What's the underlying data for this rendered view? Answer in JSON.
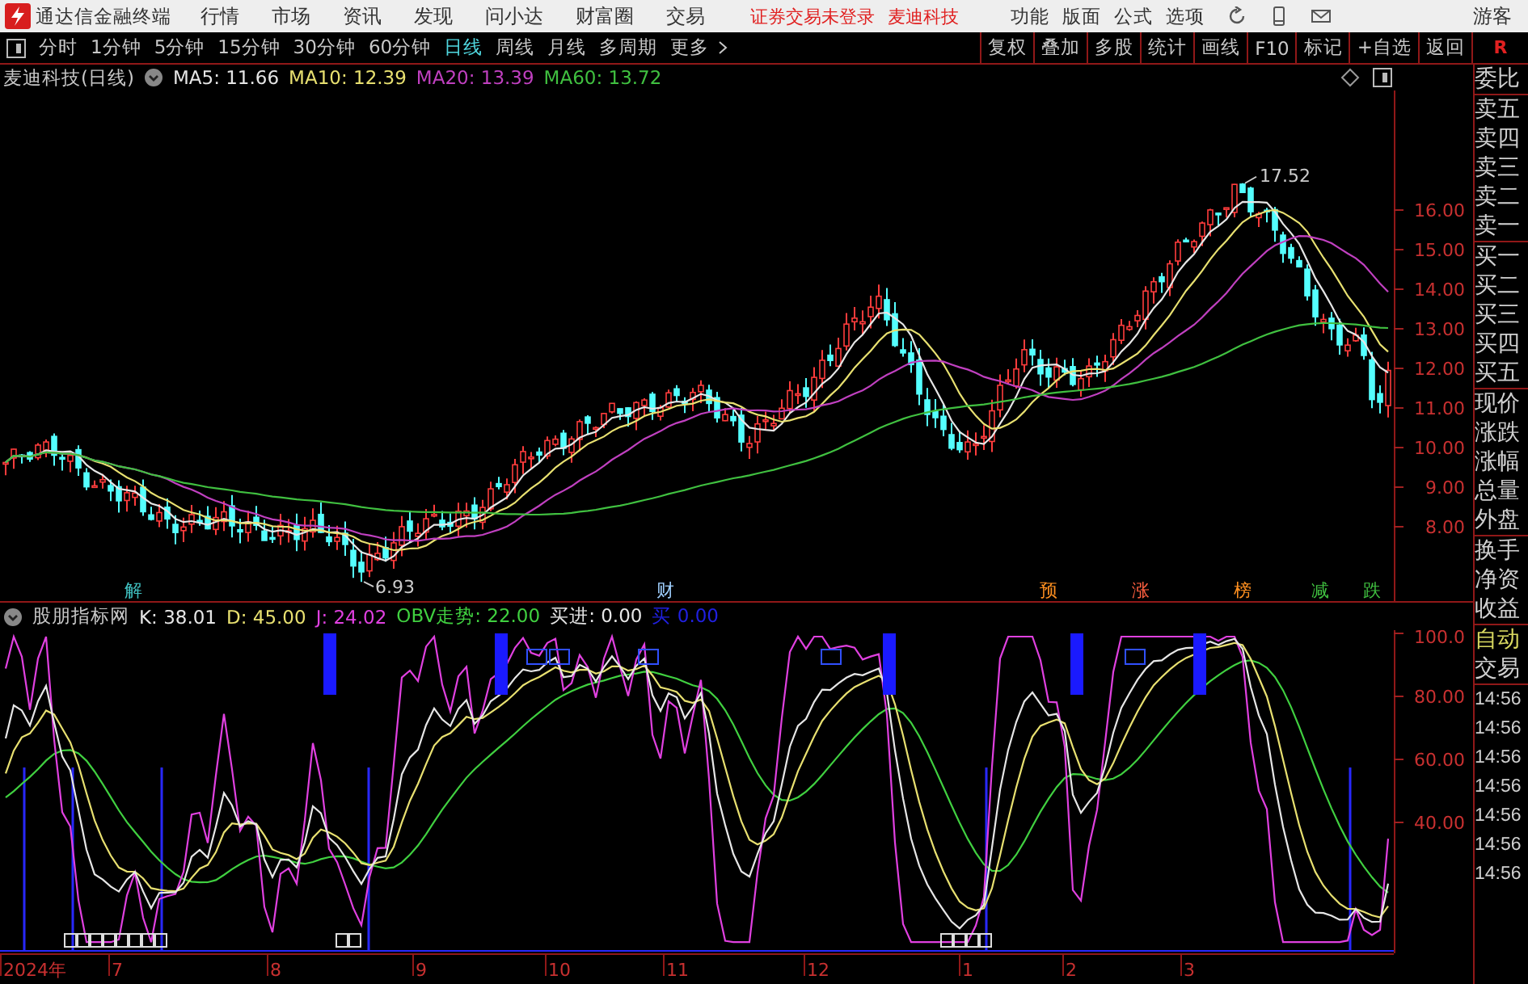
{
  "menu_bar": {
    "app_name": "通达信金融终端",
    "items": [
      "行情",
      "市场",
      "资讯",
      "发现",
      "问小达",
      "财富圈",
      "交易"
    ],
    "notices": [
      "证券交易未登录",
      "麦迪科技"
    ],
    "tools": [
      "功能",
      "版面",
      "公式",
      "选项"
    ],
    "user": "游客"
  },
  "toolbar": {
    "periods": [
      {
        "label": "分时",
        "selected": false
      },
      {
        "label": "1分钟",
        "selected": false
      },
      {
        "label": "5分钟",
        "selected": false
      },
      {
        "label": "15分钟",
        "selected": false
      },
      {
        "label": "30分钟",
        "selected": false
      },
      {
        "label": "60分钟",
        "selected": false
      },
      {
        "label": "日线",
        "selected": true
      },
      {
        "label": "周线",
        "selected": false
      },
      {
        "label": "月线",
        "selected": false
      },
      {
        "label": "多周期",
        "selected": false
      },
      {
        "label": "更多",
        "selected": false
      }
    ],
    "actions": [
      "复权",
      "叠加",
      "多股",
      "统计",
      "画线",
      "F10",
      "标记",
      "+自选",
      "返回"
    ],
    "corner": "R"
  },
  "price_chart": {
    "title": "麦迪科技(日线)",
    "indicators": [
      {
        "label": "MA5: 11.66",
        "color": "#e6e6e6"
      },
      {
        "label": "MA10: 12.39",
        "color": "#e8e070"
      },
      {
        "label": "MA20: 13.39",
        "color": "#c040c0"
      },
      {
        "label": "MA60: 13.72",
        "color": "#40c040"
      }
    ],
    "high_label": "17.52",
    "low_label": "6.93",
    "events": [
      {
        "label": "解",
        "color": "#40c0c0"
      },
      {
        "label": "财",
        "color": "#a0d0ff"
      },
      {
        "label": "预",
        "color": "#ff9020"
      },
      {
        "label": "涨",
        "color": "#ff6040"
      },
      {
        "label": "榜",
        "color": "#ff9020"
      },
      {
        "label": "减",
        "color": "#40c040"
      },
      {
        "label": "跌",
        "color": "#40c040"
      }
    ],
    "yticks": [
      "16.00",
      "15.00",
      "14.00",
      "13.00",
      "12.00",
      "11.00",
      "10.00",
      "9.00",
      "8.00"
    ]
  },
  "indicator_chart": {
    "title": "股朋指标网",
    "values": [
      {
        "label": "K: 38.01",
        "color": "#e6e6e6"
      },
      {
        "label": "D: 45.00",
        "color": "#e8e070"
      },
      {
        "label": "J: 24.02",
        "color": "#e040e0"
      },
      {
        "label": "OBV走势: 22.00",
        "color": "#40d040"
      },
      {
        "label": "买进: 0.00",
        "color": "#e6e6e6"
      },
      {
        "label": "买 0.00",
        "color": "#2020e0"
      }
    ],
    "yticks": [
      "100.0",
      "80.00",
      "60.00",
      "40.00"
    ]
  },
  "date_axis": [
    "2024年",
    "7",
    "8",
    "9",
    "10",
    "11",
    "12",
    "1",
    "2",
    "3"
  ],
  "side_panel": {
    "quote_groups": [
      [
        "委比"
      ],
      [
        "卖五",
        "卖四",
        "卖三",
        "卖二",
        "卖一"
      ],
      [
        "买一",
        "买二",
        "买三",
        "买四",
        "买五"
      ],
      [
        "现价",
        "涨跌",
        "涨幅",
        "总量",
        "外盘"
      ],
      [
        "换手",
        "净资",
        "收益"
      ]
    ],
    "trade_labels": [
      "自动",
      "交易"
    ],
    "times": [
      "14:56",
      "14:56",
      "14:56",
      "14:56",
      "14:56",
      "14:56",
      "14:56"
    ]
  }
}
